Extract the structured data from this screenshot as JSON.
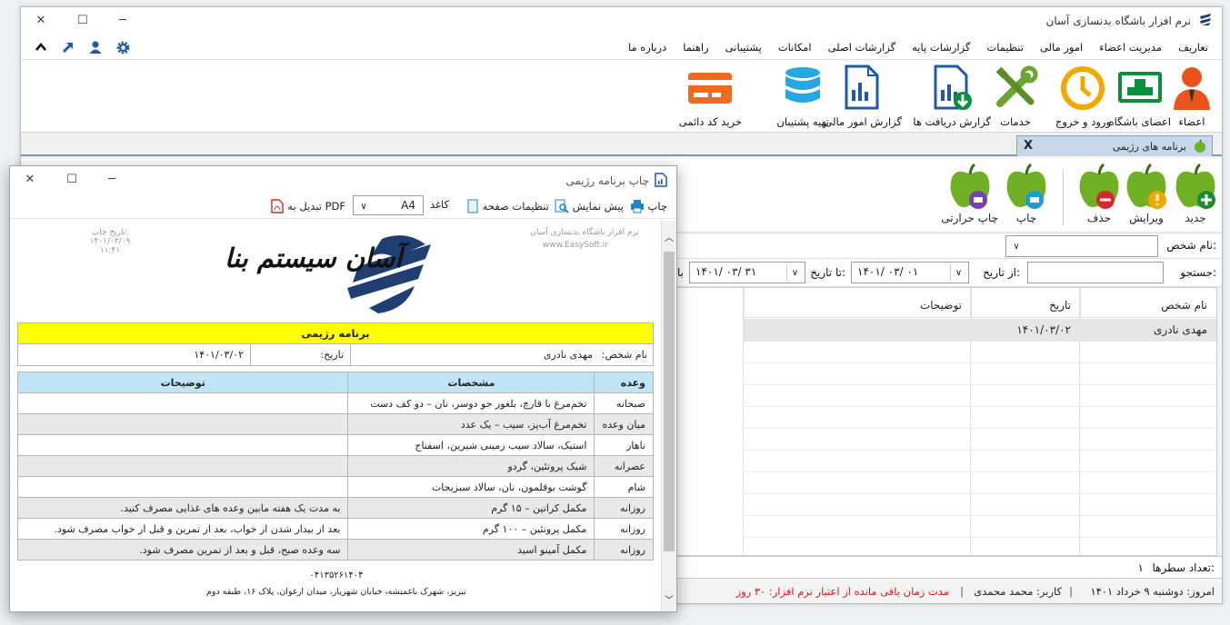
{
  "window": {
    "title": "نرم افزار باشگاه بدنسازی آسان",
    "minimize": "─",
    "maximize": "☐",
    "close": "✕"
  },
  "menu": [
    "تعاریف",
    "مدیریت اعضاء",
    "امور مالی",
    "تنظیمات",
    "گزارشات پایه",
    "گزارشات اصلی",
    "امکانات",
    "پشتیبانی",
    "راهنما",
    "درباره ما"
  ],
  "ribbon": [
    {
      "label": "اعضاء",
      "icon": "person-icon"
    },
    {
      "label": "اعضای باشگاه",
      "icon": "members-icon"
    },
    {
      "label": "ورود و خروج",
      "icon": "clock-icon"
    },
    {
      "label": "خدمات",
      "icon": "tools-icon"
    },
    {
      "label": "گزارش دریافت ها",
      "icon": "download-report-icon"
    },
    {
      "label": "گزارش امور مالی",
      "icon": "finance-report-icon"
    },
    {
      "label": "تهیه پشتیبان",
      "icon": "database-icon"
    },
    {
      "label": "خرید کد دائمی",
      "icon": "credit-card-icon"
    }
  ],
  "tab": {
    "label": "برنامه های رژیمی",
    "close": "X"
  },
  "actions": [
    {
      "label": "جدید",
      "icon": "apple-add-icon"
    },
    {
      "label": "ویرایش",
      "icon": "apple-edit-icon"
    },
    {
      "label": "حذف",
      "icon": "apple-delete-icon"
    },
    {
      "label": "چاپ",
      "icon": "apple-print-icon"
    },
    {
      "label": "چاپ حرارتی",
      "icon": "apple-thermal-print-icon"
    }
  ],
  "filters": {
    "person_label": "نام شخص:",
    "search_label": "جستجو:",
    "from_label": "از تاریخ:",
    "from_date": "۱۴۰۱/ ۰۳/ ۰۱",
    "to_label": "تا تاریخ:",
    "to_date": "۱۴۰۱/ ۰۳/ ۳۱",
    "trailing": "با"
  },
  "grid": {
    "headers": [
      "نام شخص",
      "تاریخ",
      "توضیحات"
    ],
    "rows": [
      [
        "مهدی نادری",
        "۱۴۰۱/۰۳/۰۲",
        ""
      ]
    ]
  },
  "row_count_label": "تعداد سطرها:",
  "row_count": "۱",
  "status": {
    "today": "امروز: دوشنبه ۹ خرداد ۱۴۰۱",
    "user": "کاربر: محمد محمدی",
    "expiry": "مدت زمان باقی مانده از اعتبار نرم افزار: ۳۰ روز"
  },
  "dialog": {
    "title": "چاپ برنامه رژیمی",
    "print": "چاپ",
    "preview": "پیش نمایش",
    "page_setup": "تنظیمات صفحه",
    "paper_label": "کاغذ",
    "paper_value": "A4",
    "pdf": "تبدیل به PDF"
  },
  "report": {
    "app_name": "نرم افزار باشگاه بدنسازی آسان",
    "website": "www.EasySoft.ir",
    "print_date_label": "تاریخ چاپ:",
    "print_date": "۱۴۰۱/۰۳/۰۹",
    "print_time": "۱۱:۴۱",
    "logo_text": "آسان سیستم بنا",
    "heading": "برنامه رژیمی",
    "person_label": "نام شخص:",
    "person_value": "مهدی نادری",
    "date_label": "تاریخ:",
    "date_value": "۱۴۰۱/۰۳/۰۲",
    "columns": [
      "وعده",
      "مشخصات",
      "توضیحات"
    ],
    "rows": [
      [
        "صبحانه",
        "تخم‌مرغ با قارچ، بلغور جو دوسر، نان – دو کف دست",
        ""
      ],
      [
        "میان وعده",
        "تخم‌مرغ آب‌پز، سیب – یک عدد",
        ""
      ],
      [
        "ناهار",
        "استیک، سالاد سیب زمینی شیرین، اسفناج",
        ""
      ],
      [
        "عصرانه",
        "شیک پروتئین، گردو",
        ""
      ],
      [
        "شام",
        "گوشت بوقلمون، نان، سالاد سبزیجات",
        ""
      ],
      [
        "روزانه",
        "مکمل کراتین – ۱۵ گرم",
        "به مدت یک هفته مابین وعده های غذایی مصرف کنید."
      ],
      [
        "روزانه",
        "مکمل پروتئین – ۱۰۰ گرم",
        "بعد از بیدار شدن از خواب، بعد از تمرین و قبل از خواب مصرف شود."
      ],
      [
        "روزانه",
        "مکمل آمینو اسید",
        "سه وعده صبح، قبل و بعد از تمرین مصرف شود."
      ]
    ],
    "phone": "۰۴۱۳۵۲۶۱۴۰۴",
    "address": "تبریز، شهرک باغمیشه، خیابان شهریار، میدان ارغوان، پلاک ۱۶، طبقه دوم"
  }
}
